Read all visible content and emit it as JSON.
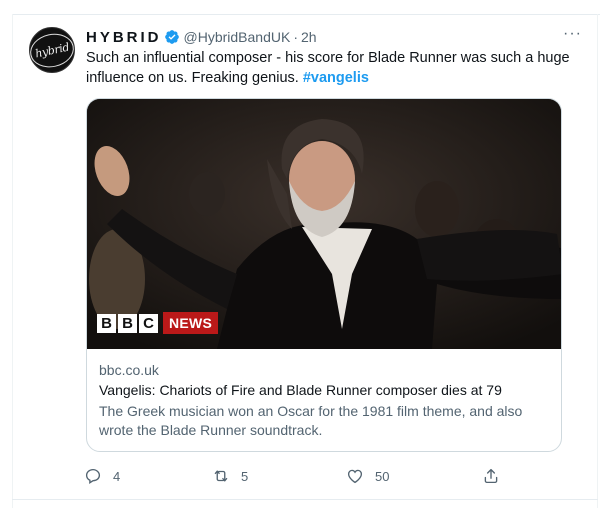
{
  "tweet": {
    "display_name": "HYBRID",
    "handle": "@HybridBandUK",
    "separator": "·",
    "time": "2h",
    "more_label": "···",
    "avatar_text": "hybrid",
    "text": "Such an influential composer - his score for Blade Runner was such a huge influence on us. Freaking genius. ",
    "hashtag": "#vangelis"
  },
  "card": {
    "badge_letters": [
      "B",
      "B",
      "C"
    ],
    "badge_news": "NEWS",
    "domain": "bbc.co.uk",
    "title": "Vangelis: Chariots of Fire and Blade Runner composer dies at 79",
    "description": "The Greek musician won an Oscar for the 1981 film theme, and also wrote the Blade Runner soundtrack."
  },
  "actions": {
    "reply": {
      "icon": "reply-icon",
      "count": "4"
    },
    "retweet": {
      "icon": "retweet-icon",
      "count": "5"
    },
    "like": {
      "icon": "heart-icon",
      "count": "50"
    },
    "share": {
      "icon": "share-icon"
    }
  },
  "colors": {
    "accent": "#1d9bf0",
    "secondary_text": "#536471",
    "bbc_red": "#bb1919"
  }
}
